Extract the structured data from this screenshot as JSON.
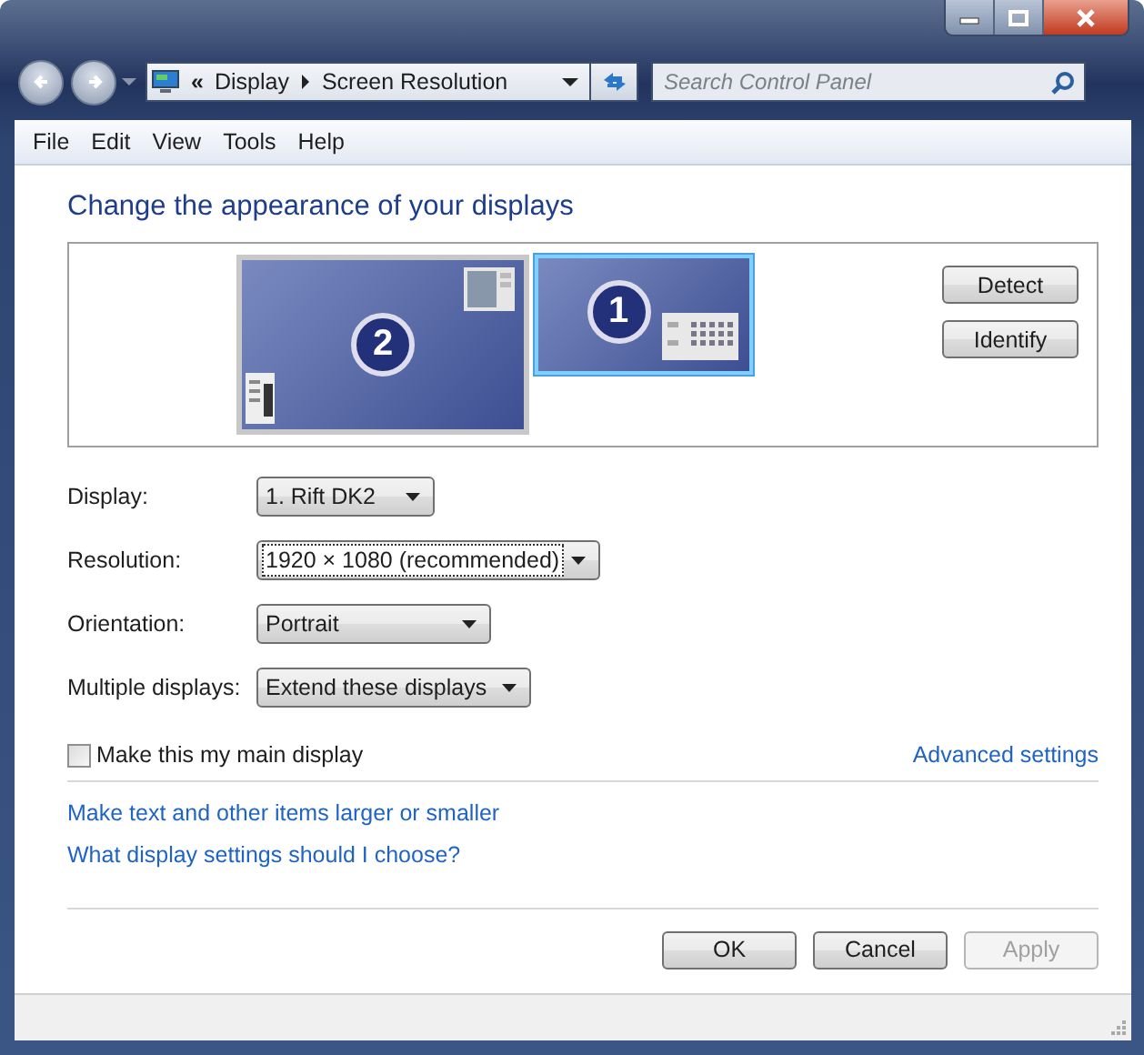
{
  "window": {
    "buttons": [
      {
        "kind": "minimize"
      },
      {
        "kind": "maximize"
      },
      {
        "kind": "close"
      }
    ]
  },
  "address_bar": {
    "overflow": "«",
    "crumbs": [
      "Display",
      "Screen Resolution"
    ]
  },
  "search": {
    "placeholder": "Search Control Panel"
  },
  "menu": [
    "File",
    "Edit",
    "View",
    "Tools",
    "Help"
  ],
  "heading": "Change the appearance of your displays",
  "monitors": [
    {
      "number": "2",
      "selected": false
    },
    {
      "number": "1",
      "selected": true
    }
  ],
  "monitor_buttons": [
    "Detect",
    "Identify"
  ],
  "settings": [
    {
      "label": "Display:",
      "value": "1. Rift DK2",
      "focused": false
    },
    {
      "label": "Resolution:",
      "value": "1920 × 1080 (recommended)",
      "focused": true
    },
    {
      "label": "Orientation:",
      "value": "Portrait",
      "focused": false
    },
    {
      "label": "Multiple displays:",
      "value": "Extend these displays",
      "focused": false
    }
  ],
  "main_display": {
    "label": "Make this my main display",
    "checked": false
  },
  "advanced_link": "Advanced settings",
  "links": [
    "Make text and other items larger or smaller",
    "What display settings should I choose?"
  ],
  "buttons": [
    {
      "label": "OK",
      "disabled": false
    },
    {
      "label": "Cancel",
      "disabled": false
    },
    {
      "label": "Apply",
      "disabled": true
    }
  ]
}
